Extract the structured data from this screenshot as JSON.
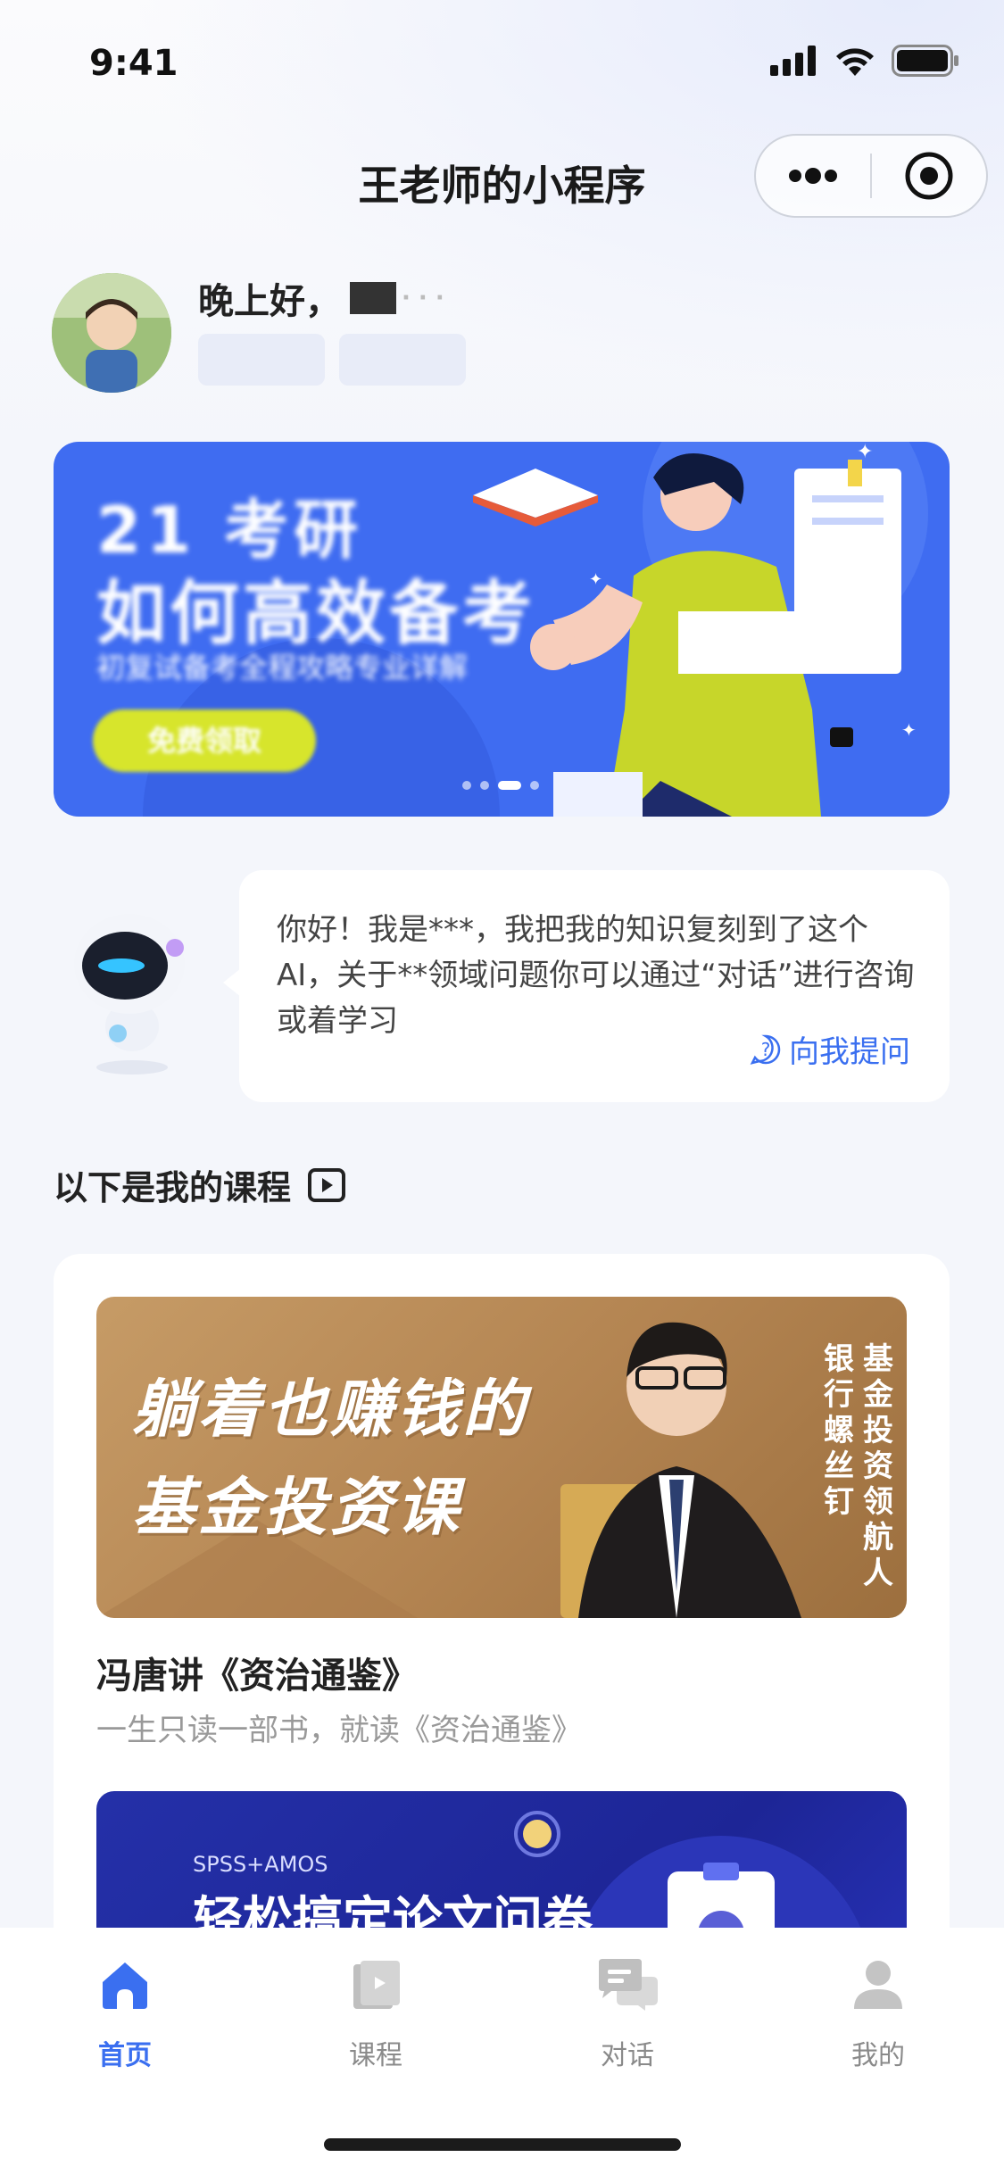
{
  "status_bar": {
    "time": "9:41"
  },
  "nav": {
    "title": "王老师的小程序"
  },
  "greeting": {
    "text": "晚上好，"
  },
  "banner": {
    "line1": "21 考研",
    "line2": "如何高效备考",
    "line3": "初复试备考全程攻略专业详解",
    "button": "免费领取"
  },
  "ai_intro": {
    "text": "你好！我是***，我把我的知识复刻到了这个AI，关于**领域问题你可以通过“对话”进行咨询或着学习",
    "ask_link": "向我提问"
  },
  "section": {
    "title": "以下是我的课程"
  },
  "courses": [
    {
      "banner_line1": "躺着也赚钱的",
      "banner_line2": "基金投资课",
      "vertical1": "银行螺丝钉",
      "vertical2": "基金投资领航人",
      "name": "冯唐讲《资治通鉴》",
      "desc": "一生只读一部书，就读《资治通鉴》"
    },
    {
      "banner_sub": "SPSS+AMOS",
      "banner_title": "轻松搞定论文问卷"
    }
  ],
  "tabbar": {
    "items": [
      {
        "label": "首页",
        "icon": "home-icon",
        "active": true
      },
      {
        "label": "课程",
        "icon": "course-icon",
        "active": false
      },
      {
        "label": "对话",
        "icon": "chat-icon",
        "active": false
      },
      {
        "label": "我的",
        "icon": "profile-icon",
        "active": false
      }
    ]
  },
  "colors": {
    "accent": "#3a6ff0",
    "banner_bg": "#3f6cf1",
    "page_bg": "#f4f6fb"
  }
}
